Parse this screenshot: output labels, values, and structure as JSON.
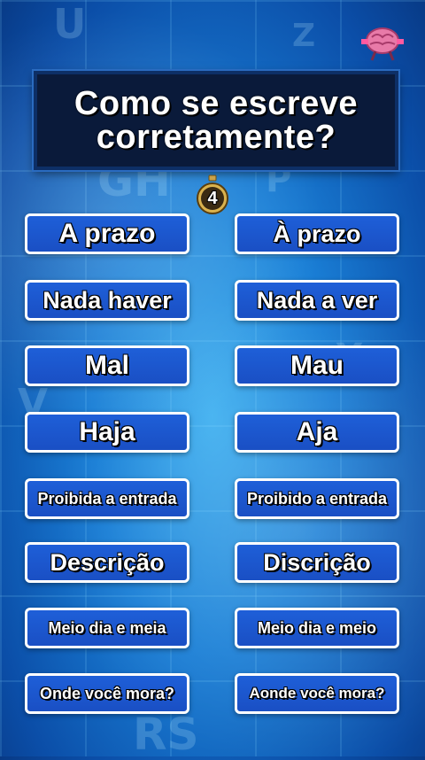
{
  "title_line1": "Como se escreve",
  "title_line2": "corretamente?",
  "timer": "4",
  "pairs": [
    {
      "left": "A prazo",
      "right": "À prazo"
    },
    {
      "left": "Nada haver",
      "right": "Nada a ver"
    },
    {
      "left": "Mal",
      "right": "Mau"
    },
    {
      "left": "Haja",
      "right": "Aja"
    },
    {
      "left": "Proibida a entrada",
      "right": "Proibido a entrada"
    },
    {
      "left": "Descrição",
      "right": "Discrição"
    },
    {
      "left": "Meio dia e meia",
      "right": "Meio dia e meio"
    },
    {
      "left": "Onde você mora?",
      "right": "Aonde você mora?"
    }
  ],
  "colors": {
    "button": "#1e5fd8",
    "title_bg": "#0a1a3a",
    "background": "#1a7fd6"
  },
  "icons": [
    "brain-mascot-icon",
    "stopwatch-icon"
  ]
}
